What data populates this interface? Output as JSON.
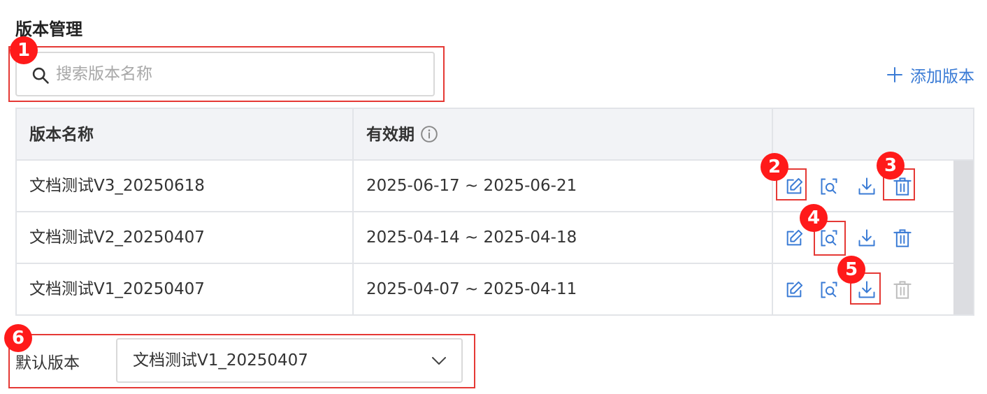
{
  "page": {
    "title": "版本管理"
  },
  "search": {
    "placeholder": "搜索版本名称",
    "icon": "search-icon"
  },
  "add_button": {
    "label": "添加版本",
    "icon": "plus-icon"
  },
  "accent_color": "#3a7bd5",
  "highlight_color": "#e53935",
  "table": {
    "columns": [
      "版本名称",
      "有效期",
      ""
    ],
    "rows": [
      {
        "name": "文档测试V3_20250618",
        "period": "2025-06-17 ~ 2025-06-21",
        "delete_enabled": true
      },
      {
        "name": "文档测试V2_20250407",
        "period": "2025-04-14 ~ 2025-04-18",
        "delete_enabled": true
      },
      {
        "name": "文档测试V1_20250407",
        "period": "2025-04-07 ~ 2025-04-11",
        "delete_enabled": false
      }
    ],
    "action_icons": [
      "edit-icon",
      "preview-icon",
      "download-icon",
      "delete-icon"
    ]
  },
  "default_version": {
    "label": "默认版本",
    "value": "文档测试V1_20250407",
    "icon": "chevron-down-icon"
  },
  "annotations": [
    "1",
    "2",
    "3",
    "4",
    "5",
    "6"
  ]
}
